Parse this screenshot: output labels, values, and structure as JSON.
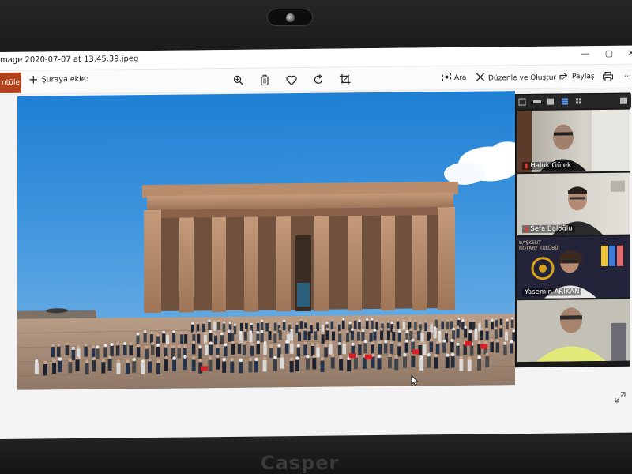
{
  "window": {
    "title": "mage 2020-07-07 at 13.45.39.jpeg",
    "controls": {
      "minimize": "—",
      "maximize": "▢",
      "close": "✕"
    }
  },
  "toolbar": {
    "view_label": "ntüle",
    "add_label": "Şuraya ekle:",
    "search_label": "Ara",
    "edit_create_label": "Düzenle ve Oluştur",
    "share_label": "Paylaş",
    "more_label": "..."
  },
  "video_call": {
    "participants": [
      {
        "name": "Haluk Gülek"
      },
      {
        "name": "Sefa Baloğlu"
      },
      {
        "name": "Yasemin ARIKAN"
      },
      {
        "name": ""
      }
    ],
    "background_text": {
      "line1": "BAŞKENT",
      "line2": "ROTARY KULÜBÜ"
    }
  },
  "device": {
    "brand": "Casper"
  },
  "colors": {
    "accent_tab": "#b3431c",
    "sky_top": "#1f7fd4",
    "stone": "#b58768",
    "mic_muted": "#e33333",
    "flag_red": "#d61f26"
  }
}
